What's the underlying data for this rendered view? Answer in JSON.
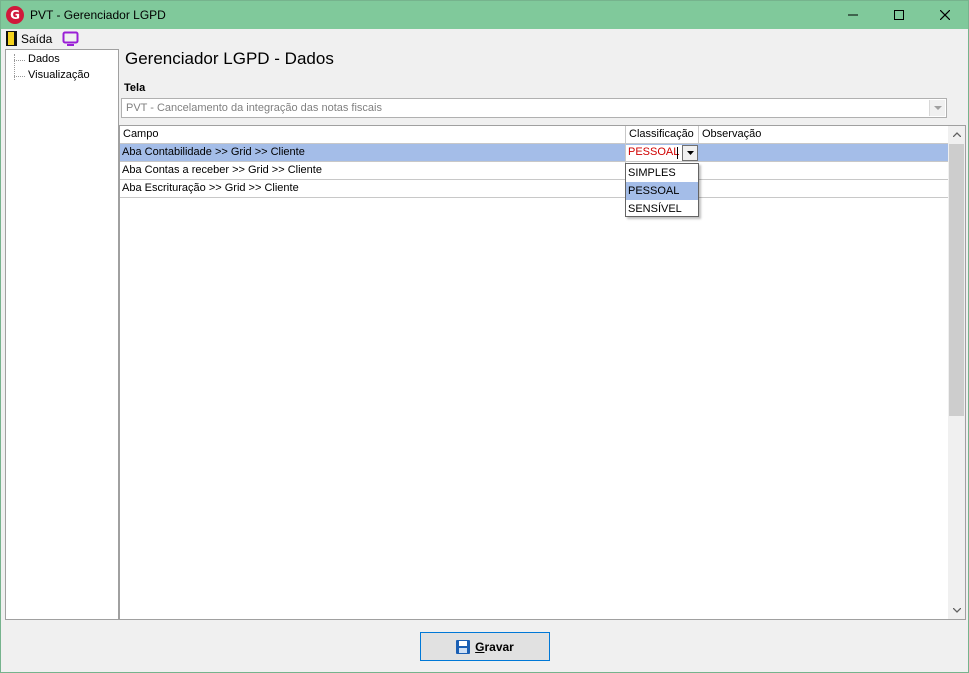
{
  "window": {
    "title": "PVT - Gerenciador LGPD",
    "logo_letter": "G"
  },
  "toolbar": {
    "exit_label": "Saída"
  },
  "sidebar": {
    "items": [
      {
        "label": "Dados"
      },
      {
        "label": "Visualização"
      }
    ]
  },
  "main": {
    "title": "Gerenciador LGPD - Dados",
    "tela_label": "Tela",
    "tela_value": "PVT - Cancelamento da integração das notas fiscais",
    "grid": {
      "columns": [
        "Campo",
        "Classificação",
        "Observação"
      ],
      "rows": [
        {
          "campo": "Aba Contabilidade >> Grid >> Cliente",
          "classificacao": "PESSOAL",
          "observacao": ""
        },
        {
          "campo": "Aba Contas a receber >> Grid >> Cliente",
          "classificacao": "",
          "observacao": ""
        },
        {
          "campo": "Aba Escrituração >> Grid >> Cliente",
          "classificacao": "",
          "observacao": ""
        }
      ],
      "dropdown_options": [
        "SIMPLES",
        "PESSOAL",
        "SENSÍVEL"
      ]
    }
  },
  "footer": {
    "save_label": "Gravar"
  },
  "colors": {
    "titlebar": "#80c99b",
    "selection": "#a4bde8",
    "editor_text": "#d00000",
    "save_icon": "#1a5fb4"
  }
}
